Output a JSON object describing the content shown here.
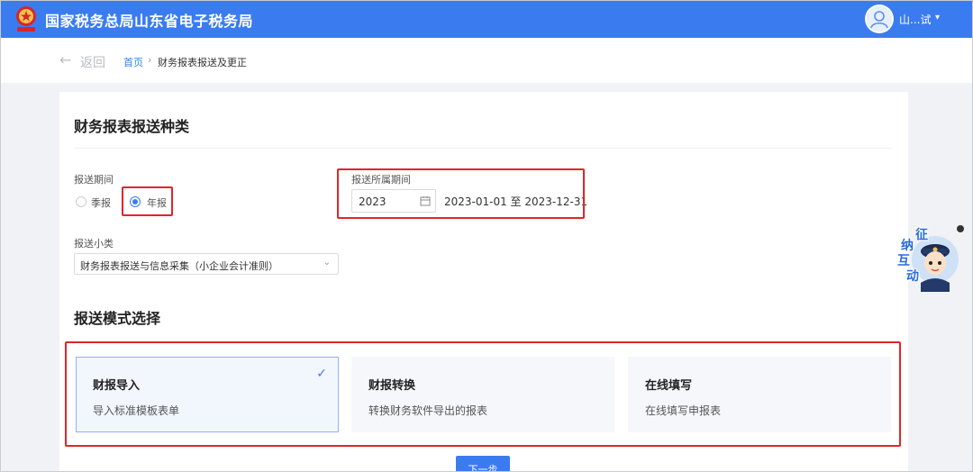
{
  "header": {
    "title": "国家税务总局山东省电子税务局",
    "user_name": "山...试",
    "logo_text": "税务"
  },
  "breadcrumb": {
    "back_label": "返回",
    "home": "首页",
    "separator": "›",
    "current": "财务报表报送及更正"
  },
  "section1": {
    "title": "财务报表报送种类",
    "period_label": "报送期间",
    "period_options": [
      {
        "label": "季报",
        "checked": false
      },
      {
        "label": "年报",
        "checked": true
      }
    ],
    "belong_period_label": "报送所属期间",
    "year_value": "2023",
    "date_range": "2023-01-01 至 2023-12-31",
    "subtype_label": "报送小类",
    "subtype_value": "财务报表报送与信息采集（小企业会计准则）"
  },
  "section2": {
    "title": "报送模式选择",
    "modes": [
      {
        "title": "财报导入",
        "desc": "导入标准模板表单",
        "selected": true
      },
      {
        "title": "财报转换",
        "desc": "转换财务软件导出的报表",
        "selected": false
      },
      {
        "title": "在线填写",
        "desc": "在线填写申报表",
        "selected": false
      }
    ]
  },
  "next_button": "下一步",
  "float_widget": {
    "chars": [
      "征",
      "纳",
      "互",
      "动"
    ]
  },
  "colors": {
    "primary": "#3a7cf0",
    "highlight_border": "#e0262a"
  }
}
